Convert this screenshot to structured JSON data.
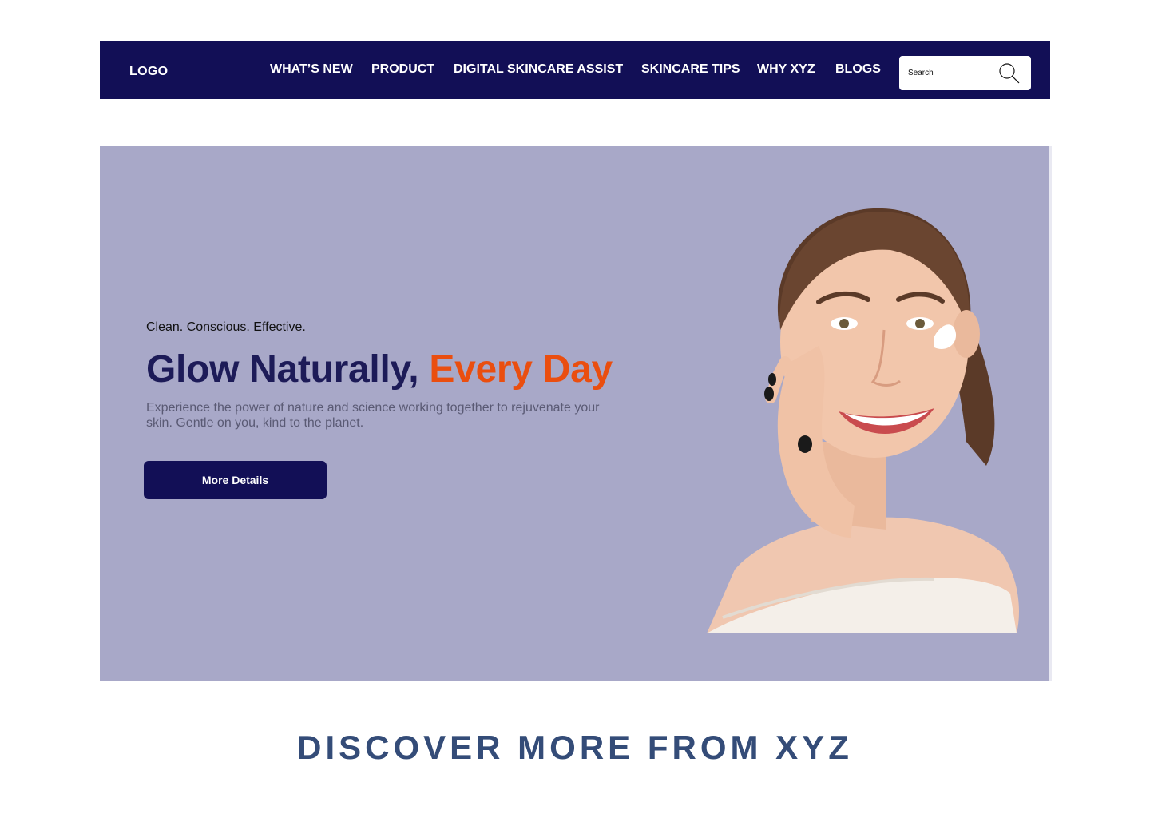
{
  "nav": {
    "logo": "LOGO",
    "links": [
      {
        "label": "WHAT’S NEW"
      },
      {
        "label": "PRODUCT"
      },
      {
        "label": "DIGITAL SKINCARE ASSIST"
      },
      {
        "label": "SKINCARE TIPS"
      },
      {
        "label": "WHY XYZ"
      },
      {
        "label": "BLOGS"
      }
    ],
    "search": {
      "placeholder": "Search",
      "icon": "search-icon"
    }
  },
  "hero": {
    "tagline": "Clean. Conscious. Effective.",
    "title_main": "Glow Naturally,",
    "title_accent": "Every Day",
    "description": "Experience the power of nature and science working together to rejuvenate your skin. Gentle on you, kind to the planet.",
    "cta_label": "More Details"
  },
  "discover": {
    "title": "DISCOVER MORE FROM XYZ"
  },
  "colors": {
    "nav_bg": "#120f56",
    "hero_bg": "#a8a8c8",
    "accent": "#ea4e0f",
    "title": "#1d1b58",
    "section_title": "#344c78"
  }
}
